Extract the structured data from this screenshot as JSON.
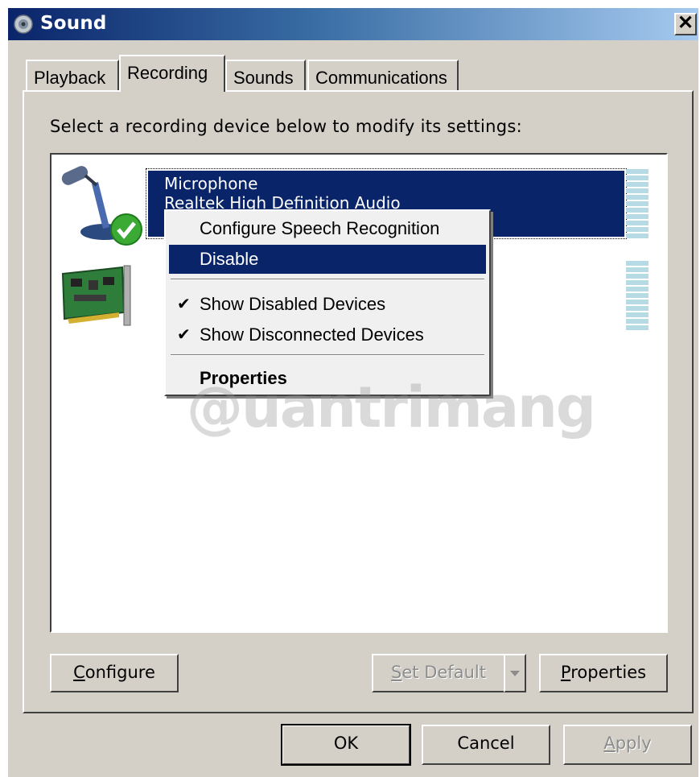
{
  "window": {
    "title": "Sound",
    "close_glyph": "✕"
  },
  "tabs": [
    {
      "label": "Playback",
      "active": false
    },
    {
      "label": "Recording",
      "active": true
    },
    {
      "label": "Sounds",
      "active": false
    },
    {
      "label": "Communications",
      "active": false
    }
  ],
  "recording": {
    "instruction": "Select a recording device below to modify its settings:",
    "devices": [
      {
        "name": "Microphone",
        "description": "Realtek High Definition Audio",
        "icon": "microphone-icon",
        "status": "default-device-check"
      },
      {
        "name": "",
        "description": "",
        "icon": "sound-card-icon"
      }
    ]
  },
  "context_menu": {
    "items": [
      {
        "label": "Configure Speech Recognition",
        "checked": false,
        "highlighted": false
      },
      {
        "label": "Disable",
        "checked": false,
        "highlighted": true
      },
      {
        "label": "Show Disabled Devices",
        "checked": true,
        "highlighted": false
      },
      {
        "label": "Show Disconnected Devices",
        "checked": true,
        "highlighted": false
      },
      {
        "label": "Properties",
        "bold": true,
        "highlighted": false
      }
    ],
    "check_glyph": "✔"
  },
  "buttons": {
    "configure": {
      "prefix": "",
      "mnemonic": "C",
      "suffix": "onfigure"
    },
    "set_default": {
      "prefix": "",
      "mnemonic": "S",
      "suffix": "et Default"
    },
    "properties": {
      "prefix": "",
      "mnemonic": "P",
      "suffix": "roperties"
    },
    "ok": "OK",
    "cancel": "Cancel",
    "apply": {
      "prefix": "",
      "mnemonic": "A",
      "suffix": "pply"
    }
  },
  "watermark": "@uantrimang"
}
